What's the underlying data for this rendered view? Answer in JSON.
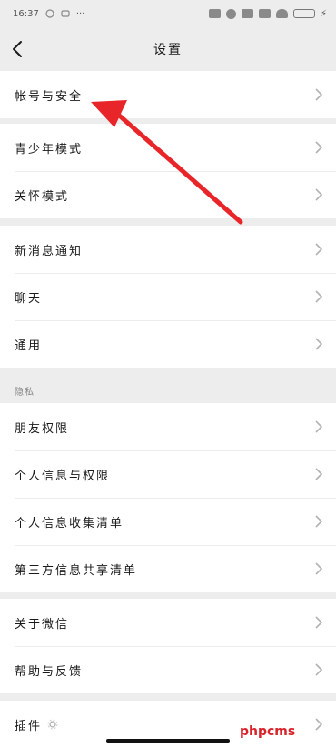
{
  "status_bar": {
    "time": "16:37",
    "dots": "···",
    "battery": "100"
  },
  "nav": {
    "title": "设置"
  },
  "groups": [
    {
      "items": [
        {
          "label": "帐号与安全"
        }
      ]
    },
    {
      "items": [
        {
          "label": "青少年模式"
        },
        {
          "label": "关怀模式"
        }
      ]
    },
    {
      "items": [
        {
          "label": "新消息通知"
        },
        {
          "label": "聊天"
        },
        {
          "label": "通用"
        }
      ]
    },
    {
      "header": "隐私",
      "items": [
        {
          "label": "朋友权限"
        },
        {
          "label": "个人信息与权限"
        },
        {
          "label": "个人信息收集清单"
        },
        {
          "label": "第三方信息共享清单"
        }
      ]
    },
    {
      "items": [
        {
          "label": "关于微信"
        },
        {
          "label": "帮助与反馈"
        }
      ]
    },
    {
      "items": [
        {
          "label": "插件"
        }
      ]
    }
  ],
  "watermark": "phpcms",
  "annotation": {
    "color": "#e8262a"
  }
}
